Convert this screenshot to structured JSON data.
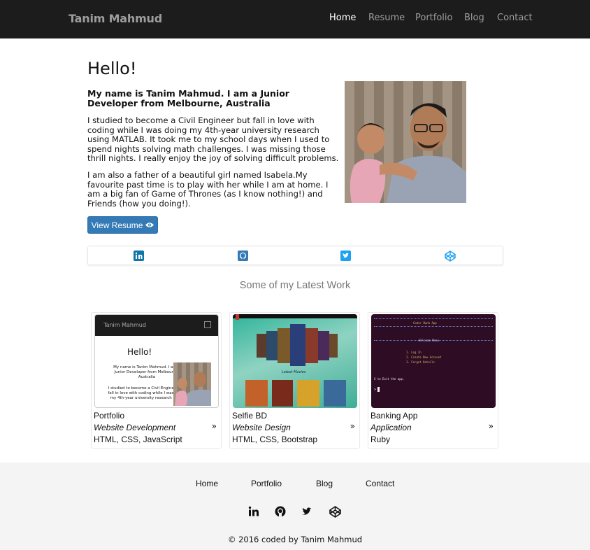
{
  "navbar": {
    "brand": "Tanim Mahmud",
    "links": [
      {
        "label": "Home",
        "active": true
      },
      {
        "label": "Resume",
        "active": false
      },
      {
        "label": "Portfolio",
        "active": false
      },
      {
        "label": "Blog",
        "active": false
      },
      {
        "label": "Contact",
        "active": false
      }
    ]
  },
  "intro": {
    "heading": "Hello!",
    "subheading": "My name is Tanim Mahmud. I am a Junior Developer from Melbourne, Australia",
    "paragraph1": "I studied to become a Civil Engineer but fall in love with coding while I was doing my 4th-year university research using MATLAB. It took me to my school days when I used to spend nights solving math challenges. I was missing those thrill nights. I really enjoy the joy of solving difficult problems.",
    "paragraph2": "I am also a father of a beautiful girl named Isabela.My favourite past time is to play with her while I am at home. I am a big fan of Game of Thrones (as I know nothing!) and Friends (how you doing!).",
    "resume_button": "View Resume",
    "resume_icon": "eye-icon"
  },
  "social": {
    "icons": [
      "linkedin-icon",
      "github-icon",
      "twitter-icon",
      "codepen-icon"
    ],
    "colors": {
      "linkedin": "#0e76a8",
      "github": "#337ab7",
      "twitter": "#1da1f2",
      "codepen": "#1da1f2"
    }
  },
  "work": {
    "title": "Some of my Latest Work",
    "cards": [
      {
        "title": "Portfolio",
        "category": "Website Development",
        "tech": "HTML, CSS, JavaScript",
        "thumb": {
          "brand": "Tanim Mahmud",
          "hello": "Hello!",
          "text1": "My name is Tanim Mahmud. I am a Junior Developer from Melbourne, Australia",
          "text2": "I studied to become a Civil Engineer but fall in love with coding while I was doing my 4th-year university research using"
        }
      },
      {
        "title": "Selfie BD",
        "category": "Website Design",
        "tech": "HTML, CSS, Bootstrap",
        "thumb": {
          "caption": "Latest Movies"
        }
      },
      {
        "title": "Banking App",
        "category": "Application",
        "tech": "Ruby",
        "thumb": {
          "line1": "Coder Bank App",
          "line2": "Welcome Menu",
          "opt1": "1. Log In",
          "opt2": "2. Create New Account",
          "opt3": "3. Forgot Details",
          "exit": "X to Exit the app.",
          "prompt": ">"
        }
      }
    ]
  },
  "footer": {
    "links": [
      "Home",
      "Portfolio",
      "Blog",
      "Contact"
    ],
    "icons": [
      "linkedin-icon",
      "github-icon",
      "twitter-icon",
      "codepen-icon"
    ],
    "copyright": "© 2016 coded by Tanim Mahmud"
  }
}
